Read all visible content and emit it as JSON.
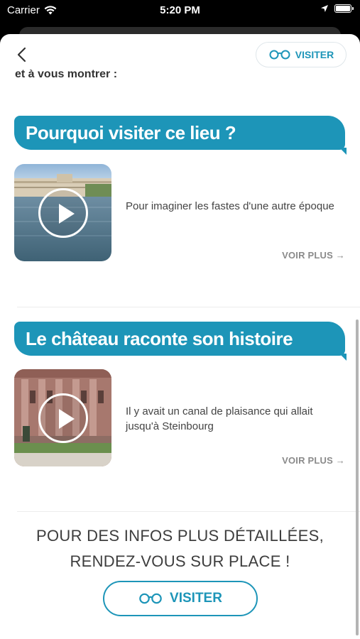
{
  "status_bar": {
    "carrier": "Carrier",
    "time": "5:20 PM"
  },
  "header": {
    "visit_label": "VISITER"
  },
  "intro_text": "et à vous montrer :",
  "sections": [
    {
      "title": "Pourquoi visiter ce lieu ?",
      "description": "Pour imaginer les fastes d'une autre époque",
      "see_more": "VOIR PLUS →"
    },
    {
      "title": "Le château raconte son histoire",
      "description": "Il y avait un canal de plaisance qui allait jusqu'à Steinbourg",
      "see_more": "VOIR PLUS →"
    }
  ],
  "footer": {
    "line1": "POUR DES INFOS PLUS DÉTAILLÉES,",
    "line2": "RENDEZ-VOUS SUR PLACE !",
    "visit_label": "VISITER"
  },
  "colors": {
    "accent": "#1d95b8"
  }
}
